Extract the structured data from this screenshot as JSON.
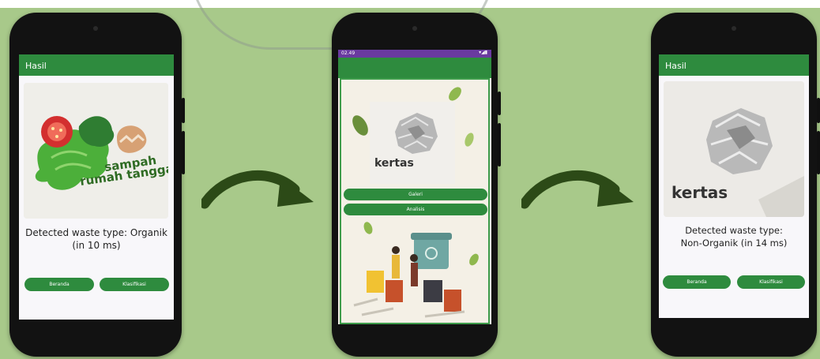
{
  "phone1": {
    "appbar_title": "Hasil",
    "image_text_line1": "sampah",
    "image_text_line2": "rumah tangga",
    "result_line1": "Detected waste type: Organik",
    "result_line2": "(in 10 ms)",
    "button_home": "Beranda",
    "button_classify": "Klasifikasi"
  },
  "phone2": {
    "status_time": "02.49",
    "image_label": "kertas",
    "button_gallery": "Galeri",
    "button_analysis": "Analisis"
  },
  "phone3": {
    "appbar_title": "Hasil",
    "image_label": "kertas",
    "result_line1": "Detected waste type:",
    "result_line2": "Non-Organik (in 14 ms)",
    "button_home": "Beranda",
    "button_classify": "Klasifikasi"
  },
  "colors": {
    "background": "#a8c98a",
    "appbar": "#2e8b3e",
    "arrow": "#2c4a17"
  }
}
